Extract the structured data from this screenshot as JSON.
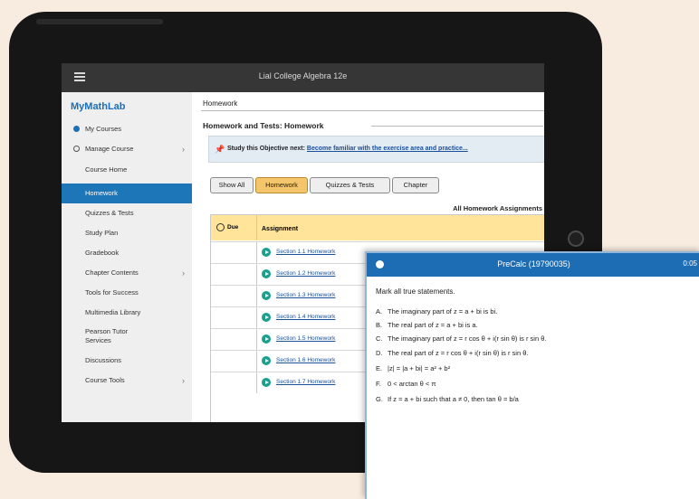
{
  "app": {
    "course_title": "Lial College Algebra 12e",
    "logo": "MyMathLab"
  },
  "sidebar": {
    "items": [
      {
        "label": "My Courses"
      },
      {
        "label": "Manage Course"
      },
      {
        "label": "Course Home"
      },
      {
        "label": "Homework"
      },
      {
        "label": "Quizzes & Tests"
      },
      {
        "label": "Study Plan"
      },
      {
        "label": "Gradebook"
      },
      {
        "label": "Chapter Contents"
      },
      {
        "label": "Tools for Success"
      },
      {
        "label": "Multimedia Library"
      },
      {
        "label": "Pearson Tutor Services"
      },
      {
        "label": "Discussions"
      },
      {
        "label": "Course Tools"
      }
    ],
    "active_index": 3
  },
  "main": {
    "breadcrumb": "Homework",
    "section_title": "Homework and Tests: Homework",
    "objective_prefix": "Study this Objective next:",
    "objective_link": "Become familiar with the exercise area and practice...",
    "filters": [
      "Show All",
      "Homework",
      "Quizzes & Tests",
      "Chapter"
    ],
    "selected_filter": "Homework",
    "table_caption": "All Homework Assignments",
    "columns": {
      "due": "Due",
      "assignment": "Assignment"
    },
    "assignments": [
      "Section 1.1 Homework",
      "Section 1.2 Homework",
      "Section 1.3 Homework",
      "Section 1.4 Homework",
      "Section 1.5 Homework",
      "Section 1.6 Homework",
      "Section 1.7 Homework"
    ]
  },
  "overlay": {
    "title": "PreCalc (19790035)",
    "timer": "0:05",
    "prompt": "Mark all true statements.",
    "options": [
      {
        "letter": "A.",
        "text": "The imaginary part of z = a + bi is bi."
      },
      {
        "letter": "B.",
        "text": "The real part of z = a + bi is a."
      },
      {
        "letter": "C.",
        "text": "The imaginary part of z = r cos θ + i(r sin θ) is r sin θ."
      },
      {
        "letter": "D.",
        "text": "The real part of z = r cos θ + i(r sin θ) is r sin θ."
      },
      {
        "letter": "E.",
        "text": "|z| = |a + bi| = a² + b²"
      },
      {
        "letter": "F.",
        "text": "0 < arctan θ < π"
      },
      {
        "letter": "G.",
        "text": "If z = a + bi such that a ≠ 0, then tan θ = b/a"
      }
    ]
  },
  "colors": {
    "accent": "#1d76b8",
    "header_yellow": "#ffe49a",
    "overlay_header": "#1d6db5"
  }
}
